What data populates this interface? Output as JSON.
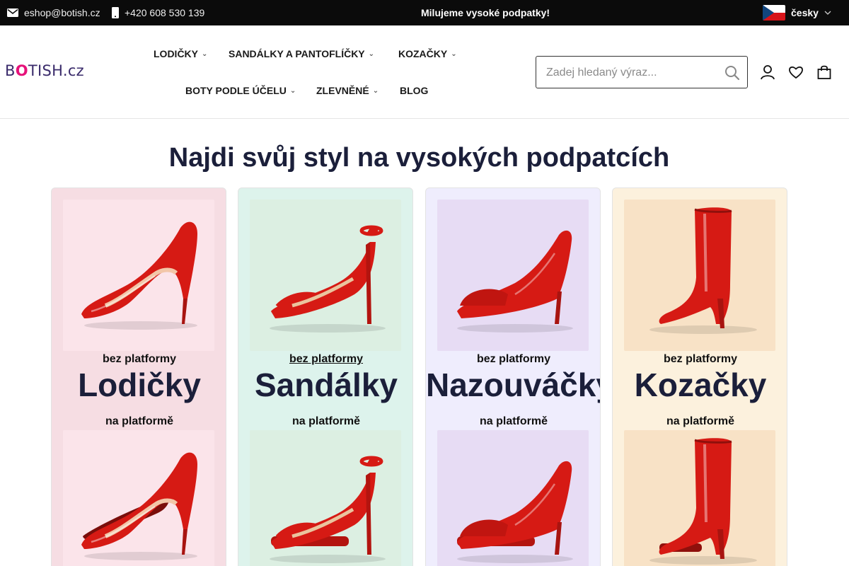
{
  "topbar": {
    "email": "eshop@botish.cz",
    "phone": "+420 608 530 139",
    "promo": "Milujeme vysoké podpatky!",
    "language": "česky"
  },
  "header": {
    "logo_prefix": "B",
    "logo_o": "O",
    "logo_suffix": "TISH.cz",
    "nav": [
      {
        "label": "LODIČKY",
        "dropdown": true
      },
      {
        "label": "SANDÁLKY A PANTOFLÍČKY",
        "dropdown": true
      },
      {
        "label": "KOZAČKY",
        "dropdown": true
      },
      {
        "label": "BOTY PODLE ÚČELU",
        "dropdown": true
      },
      {
        "label": "ZLEVNĚNÉ",
        "dropdown": true
      },
      {
        "label": "BLOG",
        "dropdown": false
      }
    ],
    "search_placeholder": "Zadej hledaný výraz..."
  },
  "main": {
    "headline": "Najdi svůj styl na vysokých podpatcích",
    "categories": [
      {
        "name": "Lodičky",
        "top_label": "bez platformy",
        "bottom_label": "na platformě",
        "bg": "#f6dde3",
        "img_bg": "#fbe4ea",
        "shoe": "pump"
      },
      {
        "name": "Sandálky",
        "top_label": "bez platformy",
        "bottom_label": "na platformě",
        "bg": "#ddf3ec",
        "img_bg": "#dcefe2",
        "shoe": "sandal"
      },
      {
        "name": "Nazouváčky",
        "top_label": "bez platformy",
        "bottom_label": "na platformě",
        "bg": "#efedfd",
        "img_bg": "#e7dcf4",
        "shoe": "mule"
      },
      {
        "name": "Kozačky",
        "top_label": "bez platformy",
        "bottom_label": "na platformě",
        "bg": "#fcf1dd",
        "img_bg": "#f8e2c6",
        "shoe": "boot"
      }
    ]
  },
  "icons": {
    "email": "mail-icon",
    "phone": "phone-icon",
    "search": "search-icon",
    "account": "user-icon",
    "wishlist": "heart-icon",
    "cart": "bag-icon"
  },
  "colors": {
    "topbar_bg": "#0b0b0b",
    "heading": "#1b1f3a",
    "shoe_red": "#d61a14",
    "logo_accent": "#e6127a"
  }
}
